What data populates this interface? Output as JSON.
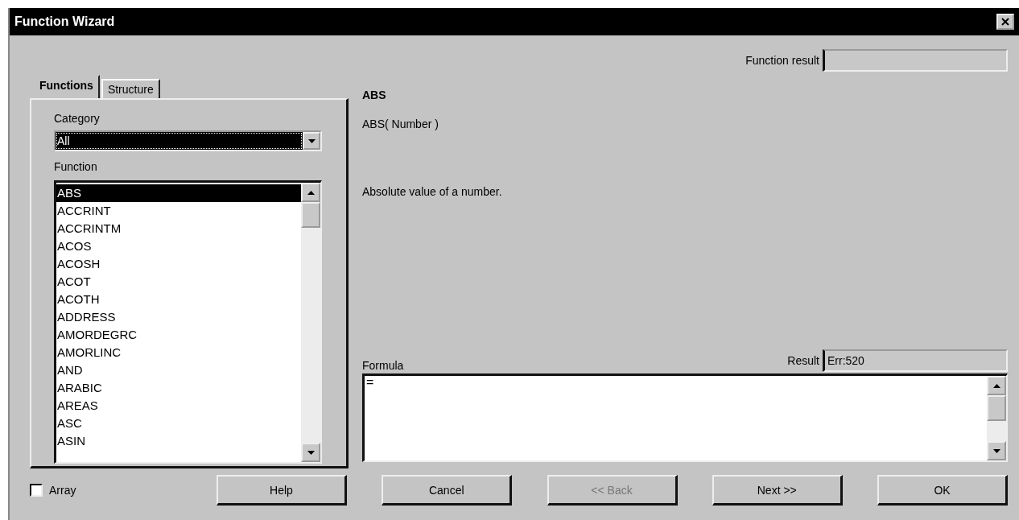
{
  "window": {
    "title": "Function Wizard"
  },
  "tabs": [
    {
      "label": "Functions",
      "selected": true
    },
    {
      "label": "Structure",
      "selected": false
    }
  ],
  "function_result": {
    "label": "Function result"
  },
  "category": {
    "label": "Category",
    "value": "All",
    "focused": true
  },
  "function_list": {
    "label": "Function",
    "items": [
      {
        "name": "ABS",
        "selected": true
      },
      {
        "name": "ACCRINT",
        "selected": false
      },
      {
        "name": "ACCRINTM",
        "selected": false
      },
      {
        "name": "ACOS",
        "selected": false
      },
      {
        "name": "ACOSH",
        "selected": false
      },
      {
        "name": "ACOT",
        "selected": false
      },
      {
        "name": "ACOTH",
        "selected": false
      },
      {
        "name": "ADDRESS",
        "selected": false
      },
      {
        "name": "AMORDEGRC",
        "selected": false
      },
      {
        "name": "AMORLINC",
        "selected": false
      },
      {
        "name": "AND",
        "selected": false
      },
      {
        "name": "ARABIC",
        "selected": false
      },
      {
        "name": "AREAS",
        "selected": false
      },
      {
        "name": "ASC",
        "selected": false
      },
      {
        "name": "ASIN",
        "selected": false
      }
    ]
  },
  "details": {
    "name": "ABS",
    "syntax": "ABS( Number )",
    "description": "Absolute value of a number."
  },
  "formula": {
    "label": "Formula",
    "value": "="
  },
  "result": {
    "label": "Result",
    "value": "Err:520"
  },
  "array": {
    "label": "Array",
    "checked": false
  },
  "buttons": [
    {
      "label": "Help",
      "disabled": false
    },
    {
      "label": "Cancel",
      "disabled": false
    },
    {
      "label": "<< Back",
      "disabled": true
    },
    {
      "label": "Next >>",
      "disabled": false
    },
    {
      "label": "OK",
      "disabled": false
    }
  ]
}
